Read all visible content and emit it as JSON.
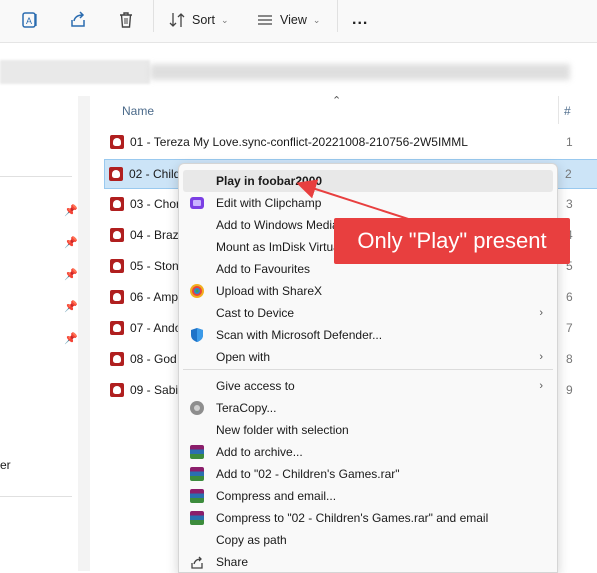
{
  "toolbar": {
    "sort_label": "Sort",
    "view_label": "View",
    "more_label": "..."
  },
  "file_list": {
    "column_name": "Name",
    "column_number": "#",
    "files": [
      {
        "name": "01 - Tereza My Love.sync-conflict-20221008-210756-2W5IMML",
        "num": "1"
      },
      {
        "name": "02 - Child",
        "num": "2"
      },
      {
        "name": "03 - Chor",
        "num": "3"
      },
      {
        "name": "04 - Brazi",
        "num": "4"
      },
      {
        "name": "05 - Ston",
        "num": "5"
      },
      {
        "name": "06 - Amp",
        "num": "6"
      },
      {
        "name": "07 - Ando",
        "num": "7"
      },
      {
        "name": "08 - God",
        "num": "8"
      },
      {
        "name": "09 - Sabia",
        "num": "9"
      }
    ]
  },
  "left_pane": {
    "partial_label": "er"
  },
  "context_menu": {
    "items": [
      {
        "label": "Play in foobar2000",
        "icon": "none",
        "highlighted": true
      },
      {
        "label": "Edit with Clipchamp",
        "icon": "clipchamp-icon"
      },
      {
        "label": "Add to Windows Media",
        "icon": "none"
      },
      {
        "label": "Mount as ImDisk Virtua",
        "icon": "none"
      },
      {
        "label": "Add to Favourites",
        "icon": "none"
      },
      {
        "label": "Upload with ShareX",
        "icon": "sharex-icon"
      },
      {
        "label": "Cast to Device",
        "icon": "none",
        "submenu": true
      },
      {
        "label": "Scan with Microsoft Defender...",
        "icon": "defender-icon"
      },
      {
        "label": "Open with",
        "icon": "none",
        "submenu": true
      },
      {
        "label": "Give access to",
        "icon": "none",
        "submenu": true
      },
      {
        "label": "TeraCopy...",
        "icon": "teracopy-icon"
      },
      {
        "label": "New folder with selection",
        "icon": "none"
      },
      {
        "label": "Add to archive...",
        "icon": "winrar-icon"
      },
      {
        "label": "Add to \"02 - Children's Games.rar\"",
        "icon": "winrar-icon"
      },
      {
        "label": "Compress and email...",
        "icon": "winrar-icon"
      },
      {
        "label": "Compress to \"02 - Children's Games.rar\" and email",
        "icon": "winrar-icon"
      },
      {
        "label": "Copy as path",
        "icon": "none"
      },
      {
        "label": "Share",
        "icon": "share-icon"
      }
    ],
    "submenu_arrow": "›"
  },
  "annotation": {
    "text": "Only \"Play\" present",
    "color": "#e83f3f"
  },
  "colors": {
    "selection": "#cce4f7",
    "file_icon": "#b01f1f"
  }
}
